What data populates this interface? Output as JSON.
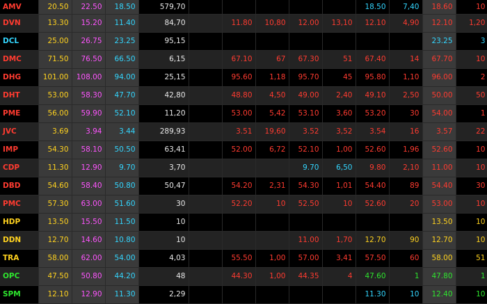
{
  "board": {
    "colors": {
      "red": "#ff3b30",
      "yellow": "#ffd21f",
      "cyan": "#33d6ff",
      "purple": "#ff55ff",
      "green": "#2ee62e",
      "white": "#e8e8e8"
    },
    "rows": [
      {
        "sym": "AMV",
        "sym_c": "red",
        "ref": "20.50",
        "ceil": "22.50",
        "floor": "18.50",
        "vol": "579,70",
        "b3": "",
        "b3v": "",
        "b3c": "",
        "b2": "",
        "b2v": "",
        "b2c": "",
        "b1": "",
        "b1v": "",
        "b1c": "",
        "mp": "18.50",
        "mp_c": "cyan",
        "mv": "7,40",
        "mv_c": "cyan",
        "s1": "18.60",
        "s1_c": "red",
        "s1v": "10",
        "s1v_c": "red"
      },
      {
        "sym": "DVN",
        "sym_c": "red",
        "ref": "13.30",
        "ceil": "15.20",
        "floor": "11.40",
        "vol": "84,70",
        "b3": "11.80",
        "b3v": "10,80",
        "b3c": "red",
        "b2": "12.00",
        "b2v": "13,10",
        "b2c": "red",
        "b1": "",
        "b1v": "",
        "b1c": "",
        "mp": "12.10",
        "mp_c": "red",
        "mv": "4,90",
        "mv_c": "red",
        "s1": "12.10",
        "s1_c": "red",
        "s1v": "1,20",
        "s1v_c": "red"
      },
      {
        "sym": "DCL",
        "sym_c": "cyan",
        "ref": "25.00",
        "ceil": "26.75",
        "floor": "23.25",
        "vol": "95,15",
        "b3": "",
        "b3v": "",
        "b3c": "",
        "b2": "",
        "b2v": "",
        "b2c": "",
        "b1": "",
        "b1v": "",
        "b1c": "",
        "mp": "",
        "mp_c": "white",
        "mv": "",
        "mv_c": "white",
        "s1": "23.25",
        "s1_c": "cyan",
        "s1v": "3",
        "s1v_c": "cyan"
      },
      {
        "sym": "DMC",
        "sym_c": "red",
        "ref": "71.50",
        "ceil": "76.50",
        "floor": "66.50",
        "vol": "6,15",
        "b3": "67.10",
        "b3v": "67",
        "b3c": "red",
        "b2": "67.30",
        "b2v": "51",
        "b2c": "red",
        "b1": "",
        "b1v": "",
        "b1c": "",
        "mp": "67.40",
        "mp_c": "red",
        "mv": "14",
        "mv_c": "red",
        "s1": "67.70",
        "s1_c": "red",
        "s1v": "10",
        "s1v_c": "red"
      },
      {
        "sym": "DHG",
        "sym_c": "red",
        "ref": "101.00",
        "ceil": "108.00",
        "floor": "94.00",
        "vol": "25,15",
        "b3": "95.60",
        "b3v": "1,18",
        "b3c": "red",
        "b2": "95.70",
        "b2v": "45",
        "b2c": "red",
        "b1": "",
        "b1v": "",
        "b1c": "",
        "mp": "95.80",
        "mp_c": "red",
        "mv": "1,10",
        "mv_c": "red",
        "s1": "96.00",
        "s1_c": "red",
        "s1v": "2",
        "s1v_c": "red"
      },
      {
        "sym": "DHT",
        "sym_c": "red",
        "ref": "53.00",
        "ceil": "58.30",
        "floor": "47.70",
        "vol": "42,80",
        "b3": "48.80",
        "b3v": "4,50",
        "b3c": "red",
        "b2": "49.00",
        "b2v": "2,40",
        "b2c": "red",
        "b1": "",
        "b1v": "",
        "b1c": "",
        "mp": "49.10",
        "mp_c": "red",
        "mv": "2,50",
        "mv_c": "red",
        "s1": "50.00",
        "s1_c": "red",
        "s1v": "50",
        "s1v_c": "red"
      },
      {
        "sym": "PME",
        "sym_c": "red",
        "ref": "56.00",
        "ceil": "59.90",
        "floor": "52.10",
        "vol": "11,20",
        "b3": "53.00",
        "b3v": "5,42",
        "b3c": "red",
        "b2": "53.10",
        "b2v": "3,60",
        "b2c": "red",
        "b1": "",
        "b1v": "",
        "b1c": "",
        "mp": "53.20",
        "mp_c": "red",
        "mv": "30",
        "mv_c": "red",
        "s1": "54.00",
        "s1_c": "red",
        "s1v": "1",
        "s1v_c": "red"
      },
      {
        "sym": "JVC",
        "sym_c": "red",
        "ref": "3.69",
        "ceil": "3.94",
        "floor": "3.44",
        "vol": "289,93",
        "b3": "3.51",
        "b3v": "19,60",
        "b3c": "red",
        "b2": "3.52",
        "b2v": "3,52",
        "b2c": "red",
        "b1": "",
        "b1v": "",
        "b1c": "",
        "mp": "3.54",
        "mp_c": "red",
        "mv": "16",
        "mv_c": "red",
        "s1": "3.57",
        "s1_c": "red",
        "s1v": "22",
        "s1v_c": "red"
      },
      {
        "sym": "IMP",
        "sym_c": "red",
        "ref": "54.30",
        "ceil": "58.10",
        "floor": "50.50",
        "vol": "63,41",
        "b3": "52.00",
        "b3v": "6,72",
        "b3c": "red",
        "b2": "52.10",
        "b2v": "1,00",
        "b2c": "red",
        "b1": "",
        "b1v": "",
        "b1c": "",
        "mp": "52.60",
        "mp_c": "red",
        "mv": "1,96",
        "mv_c": "red",
        "s1": "52.60",
        "s1_c": "red",
        "s1v": "10",
        "s1v_c": "red"
      },
      {
        "sym": "CDP",
        "sym_c": "red",
        "ref": "11.30",
        "ceil": "12.90",
        "floor": "9.70",
        "vol": "3,70",
        "b3": "",
        "b3v": "",
        "b3c": "",
        "b2": "9.70",
        "b2v": "6,50",
        "b2c": "cyan",
        "b1": "",
        "b1v": "",
        "b1c": "",
        "mp": "9.80",
        "mp_c": "red",
        "mv": "2,10",
        "mv_c": "red",
        "s1": "11.00",
        "s1_c": "red",
        "s1v": "10",
        "s1v_c": "red"
      },
      {
        "sym": "DBD",
        "sym_c": "red",
        "ref": "54.60",
        "ceil": "58.40",
        "floor": "50.80",
        "vol": "50,47",
        "b3": "54.20",
        "b3v": "2,31",
        "b3c": "red",
        "b2": "54.30",
        "b2v": "1,01",
        "b2c": "red",
        "b1": "",
        "b1v": "",
        "b1c": "",
        "mp": "54.40",
        "mp_c": "red",
        "mv": "89",
        "mv_c": "red",
        "s1": "54.40",
        "s1_c": "red",
        "s1v": "30",
        "s1v_c": "red"
      },
      {
        "sym": "PMC",
        "sym_c": "red",
        "ref": "57.30",
        "ceil": "63.00",
        "floor": "51.60",
        "vol": "30",
        "b3": "52.20",
        "b3v": "10",
        "b3c": "red",
        "b2": "52.50",
        "b2v": "10",
        "b2c": "red",
        "b1": "",
        "b1v": "",
        "b1c": "",
        "mp": "52.60",
        "mp_c": "red",
        "mv": "20",
        "mv_c": "red",
        "s1": "53.00",
        "s1_c": "red",
        "s1v": "10",
        "s1v_c": "red"
      },
      {
        "sym": "HDP",
        "sym_c": "yellow",
        "ref": "13.50",
        "ceil": "15.50",
        "floor": "11.50",
        "vol": "10",
        "b3": "",
        "b3v": "",
        "b3c": "",
        "b2": "",
        "b2v": "",
        "b2c": "",
        "b1": "",
        "b1v": "",
        "b1c": "",
        "mp": "",
        "mp_c": "white",
        "mv": "",
        "mv_c": "white",
        "s1": "13.50",
        "s1_c": "yellow",
        "s1v": "10",
        "s1v_c": "yellow"
      },
      {
        "sym": "DDN",
        "sym_c": "yellow",
        "ref": "12.70",
        "ceil": "14.60",
        "floor": "10.80",
        "vol": "10",
        "b3": "",
        "b3v": "",
        "b3c": "",
        "b2": "11.00",
        "b2v": "1,70",
        "b2c": "red",
        "b1": "",
        "b1v": "",
        "b1c": "",
        "mp": "12.70",
        "mp_c": "yellow",
        "mv": "90",
        "mv_c": "yellow",
        "s1": "12.70",
        "s1_c": "yellow",
        "s1v": "10",
        "s1v_c": "yellow"
      },
      {
        "sym": "TRA",
        "sym_c": "yellow",
        "ref": "58.00",
        "ceil": "62.00",
        "floor": "54.00",
        "vol": "4,03",
        "b3": "55.50",
        "b3v": "1,00",
        "b3c": "red",
        "b2": "57.00",
        "b2v": "3,41",
        "b2c": "red",
        "b1": "",
        "b1v": "",
        "b1c": "",
        "mp": "57.50",
        "mp_c": "red",
        "mv": "60",
        "mv_c": "red",
        "s1": "58.00",
        "s1_c": "yellow",
        "s1v": "51",
        "s1v_c": "yellow"
      },
      {
        "sym": "OPC",
        "sym_c": "green",
        "ref": "47.50",
        "ceil": "50.80",
        "floor": "44.20",
        "vol": "48",
        "b3": "44.30",
        "b3v": "1,00",
        "b3c": "red",
        "b2": "44.35",
        "b2v": "4",
        "b2c": "red",
        "b1": "",
        "b1v": "",
        "b1c": "",
        "mp": "47.60",
        "mp_c": "green",
        "mv": "1",
        "mv_c": "green",
        "s1": "47.80",
        "s1_c": "green",
        "s1v": "1",
        "s1v_c": "green"
      },
      {
        "sym": "SPM",
        "sym_c": "green",
        "ref": "12.10",
        "ceil": "12.90",
        "floor": "11.30",
        "vol": "2,29",
        "b3": "",
        "b3v": "",
        "b3c": "",
        "b2": "",
        "b2v": "",
        "b2c": "",
        "b1": "",
        "b1v": "",
        "b1c": "",
        "mp": "11.30",
        "mp_c": "cyan",
        "mv": "10",
        "mv_c": "cyan",
        "s1": "12.40",
        "s1_c": "green",
        "s1v": "10",
        "s1v_c": "green"
      }
    ]
  }
}
